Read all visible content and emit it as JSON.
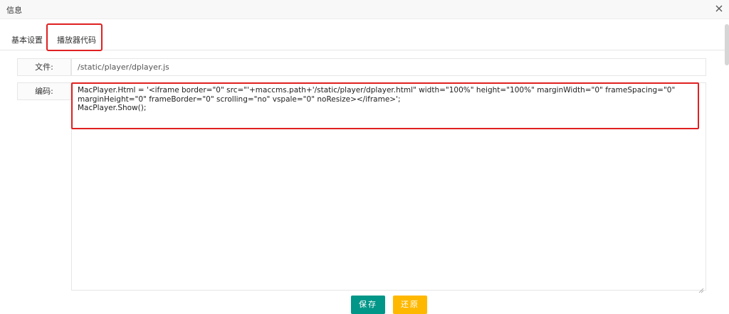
{
  "window": {
    "title": "信息"
  },
  "tabs": [
    {
      "label": "基本设置"
    },
    {
      "label": "播放器代码"
    }
  ],
  "form": {
    "file_label": "文件:",
    "file_value": "/static/player/dplayer.js",
    "code_label": "编码:",
    "code_value": "MacPlayer.Html = '<iframe border=\"0\" src=\"'+maccms.path+'/static/player/dplayer.html\" width=\"100%\" height=\"100%\" marginWidth=\"0\" frameSpacing=\"0\" marginHeight=\"0\" frameBorder=\"0\" scrolling=\"no\" vspale=\"0\" noResize></iframe>';\nMacPlayer.Show();"
  },
  "buttons": {
    "save": "保存",
    "reset": "还原"
  },
  "colors": {
    "save": "#009688",
    "reset": "#ffb800",
    "highlight": "#e02020"
  }
}
